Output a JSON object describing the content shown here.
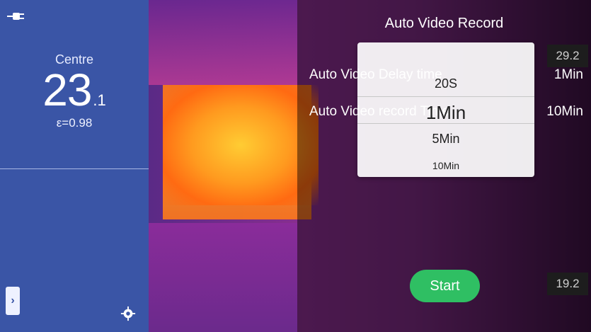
{
  "left_panel": {
    "label": "Centre",
    "temperature_int": "23",
    "temperature_dec": ".1",
    "emissivity": "ε=0.98"
  },
  "dialog": {
    "title": "Auto Video Record",
    "rows": [
      {
        "label": "Auto Video Delay time",
        "value": "1Min"
      },
      {
        "label": "Auto Video record Time",
        "value": "10Min"
      }
    ],
    "picker_options": [
      "20S",
      "1Min",
      "5Min",
      "10Min"
    ],
    "start_label": "Start"
  },
  "scale": {
    "top": "29.2",
    "bottom": "19.2"
  },
  "icons": [
    "plug-icon",
    "chevron-right-icon",
    "gear-icon"
  ],
  "colors": {
    "left_panel_bg": "#3a55a6",
    "start_button_bg": "#2fbf63"
  }
}
